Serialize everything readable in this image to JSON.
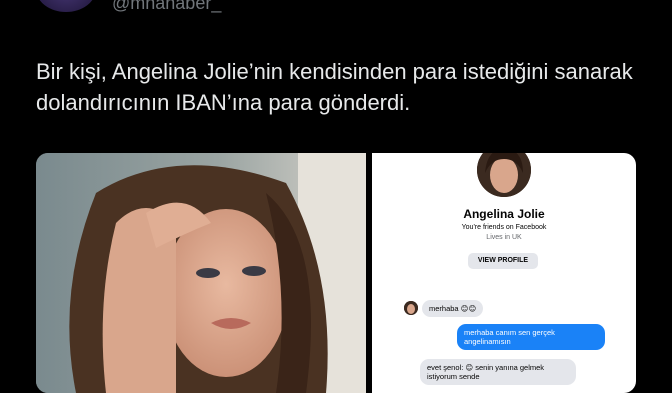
{
  "tweet": {
    "handle": "@mnahaber_",
    "text": "Bir kişi, Angelina Jolie’nin kendisinden para istediğini sanarak dolandırıcının IBAN’ına para gönderdi."
  },
  "profile_card": {
    "name": "Angelina Jolie",
    "friends_text": "You're friends on Facebook",
    "location": "Lives in UK",
    "view_profile_label": "VIEW PROFILE"
  },
  "messages": [
    {
      "direction": "incoming",
      "text": "merhaba 😊😊"
    },
    {
      "direction": "outgoing",
      "text": "merhaba canım sen gerçek angelinamısın"
    },
    {
      "direction": "incoming",
      "text": "evet şenol: 😊 senin yanına gelmek istiyorum sende"
    }
  ],
  "colors": {
    "background": "#000000",
    "text": "#e7e9ea",
    "muted": "#71767b",
    "messenger_blue": "#1a82f7",
    "bubble_gray": "#e4e6eb"
  }
}
